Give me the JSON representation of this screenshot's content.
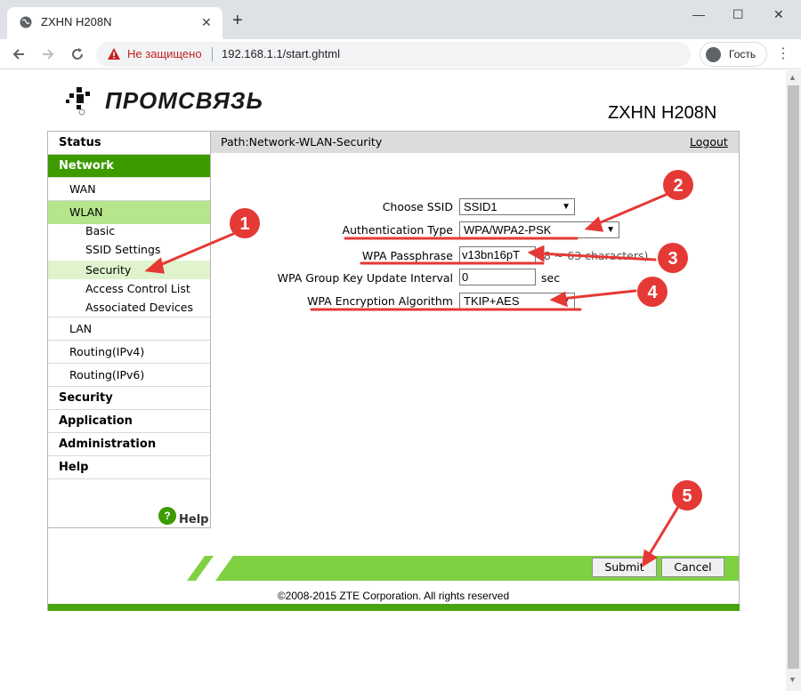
{
  "browser": {
    "tab_title": "ZXHN H208N",
    "tab_close": "✕",
    "new_tab": "+",
    "insecure_label": "Не защищено",
    "url": "192.168.1.1/start.ghtml",
    "profile_label": "Гость",
    "window_controls": [
      "—",
      "☐",
      "✕"
    ]
  },
  "header": {
    "logo_text": "ПРОМСВЯЗЬ",
    "model": "ZXHN H208N"
  },
  "sidebar": {
    "items": [
      {
        "label": "Status"
      },
      {
        "label": "Network"
      },
      {
        "label": "WAN"
      },
      {
        "label": "WLAN"
      },
      {
        "label": "Basic"
      },
      {
        "label": "SSID Settings"
      },
      {
        "label": "Security"
      },
      {
        "label": "Access Control List"
      },
      {
        "label": "Associated Devices"
      },
      {
        "label": "LAN"
      },
      {
        "label": "Routing(IPv4)"
      },
      {
        "label": "Routing(IPv6)"
      },
      {
        "label": "Security"
      },
      {
        "label": "Application"
      },
      {
        "label": "Administration"
      },
      {
        "label": "Help"
      }
    ],
    "help_icon": "?",
    "help_label": "Help"
  },
  "path": {
    "text": "Path:Network-WLAN-Security",
    "logout": "Logout"
  },
  "form": {
    "ssid_label": "Choose SSID",
    "ssid_value": "SSID1",
    "auth_label": "Authentication Type",
    "auth_value": "WPA/WPA2-PSK",
    "pass_label": "WPA Passphrase",
    "pass_value": "v13bn16pT",
    "pass_hint": "(8 ~ 63 characters)",
    "gkey_label": "WPA Group Key Update Interval",
    "gkey_value": "0",
    "gkey_unit": "sec",
    "enc_label": "WPA Encryption Algorithm",
    "enc_value": "TKIP+AES"
  },
  "actions": {
    "submit": "Submit",
    "cancel": "Cancel"
  },
  "footer": {
    "copyright": "©2008-2015 ZTE Corporation. All rights reserved"
  },
  "annotations": {
    "markers": [
      "1",
      "2",
      "3",
      "4",
      "5"
    ],
    "color": "#e53935"
  },
  "colors": {
    "nav_green": "#3d9b00",
    "nav_light": "#b6e58c",
    "bar_green": "#7fd142"
  }
}
